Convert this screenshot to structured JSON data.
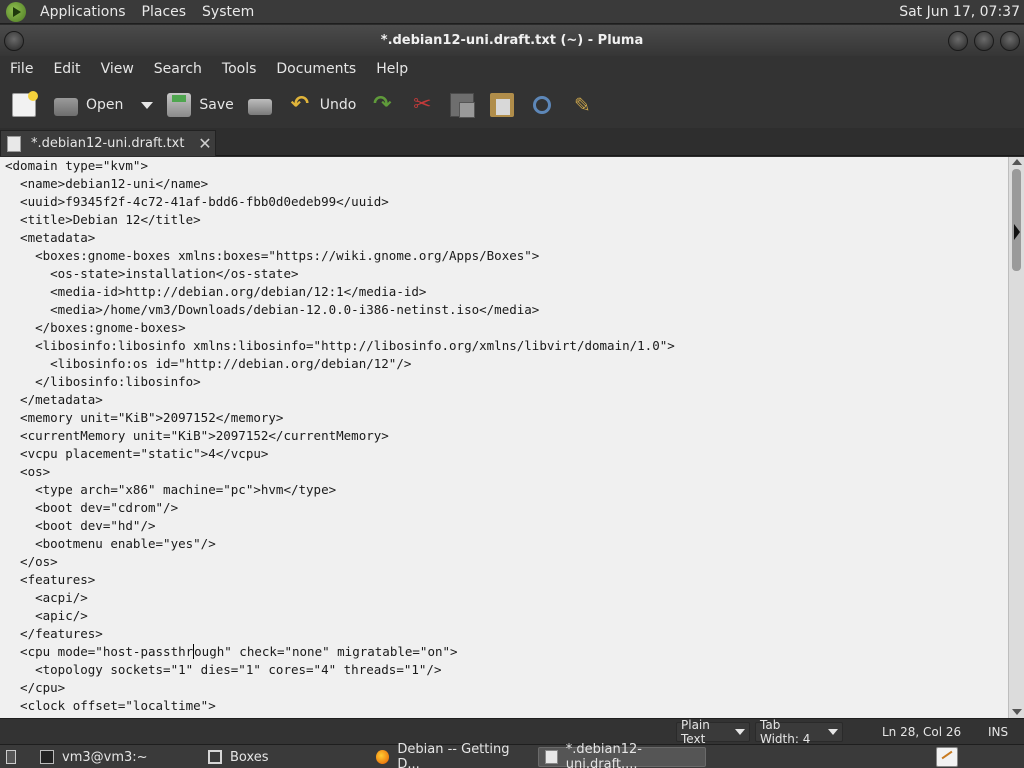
{
  "top_panel": {
    "menus": [
      "Applications",
      "Places",
      "System"
    ],
    "clock": "Sat Jun 17, 07:37"
  },
  "window": {
    "title": "*.debian12-uni.draft.txt (~) - Pluma"
  },
  "menubar": [
    "File",
    "Edit",
    "View",
    "Search",
    "Tools",
    "Documents",
    "Help"
  ],
  "toolbar": {
    "open_label": "Open",
    "save_label": "Save",
    "undo_label": "Undo"
  },
  "tab": {
    "label": "*.debian12-uni.draft.txt"
  },
  "editor": {
    "lines": [
      "<domain type=\"kvm\">",
      "  <name>debian12-uni</name>",
      "  <uuid>f9345f2f-4c72-41af-bdd6-fbb0d0edeb99</uuid>",
      "  <title>Debian 12</title>",
      "  <metadata>",
      "    <boxes:gnome-boxes xmlns:boxes=\"https://wiki.gnome.org/Apps/Boxes\">",
      "      <os-state>installation</os-state>",
      "      <media-id>http://debian.org/debian/12:1</media-id>",
      "      <media>/home/vm3/Downloads/debian-12.0.0-i386-netinst.iso</media>",
      "    </boxes:gnome-boxes>",
      "    <libosinfo:libosinfo xmlns:libosinfo=\"http://libosinfo.org/xmlns/libvirt/domain/1.0\">",
      "      <libosinfo:os id=\"http://debian.org/debian/12\"/>",
      "    </libosinfo:libosinfo>",
      "  </metadata>",
      "  <memory unit=\"KiB\">2097152</memory>",
      "  <currentMemory unit=\"KiB\">2097152</currentMemory>",
      "  <vcpu placement=\"static\">4</vcpu>",
      "  <os>",
      "    <type arch=\"x86\" machine=\"pc\">hvm</type>",
      "    <boot dev=\"cdrom\"/>",
      "    <boot dev=\"hd\"/>",
      "    <bootmenu enable=\"yes\"/>",
      "  </os>",
      "  <features>",
      "    <acpi/>",
      "    <apic/>",
      "  </features>",
      "  <cpu mode=\"host-passthrough\" check=\"none\" migratable=\"on\">",
      "    <topology sockets=\"1\" dies=\"1\" cores=\"4\" threads=\"1\"/>",
      "  </cpu>",
      "  <clock offset=\"localtime\">"
    ],
    "cursor": {
      "line": 28,
      "col": 26
    }
  },
  "statusbar": {
    "language": "Plain Text",
    "tab_width": "Tab Width:  4",
    "position": "Ln 28, Col 26",
    "mode": "INS"
  },
  "taskbar": {
    "items": [
      {
        "label": "vm3@vm3:~",
        "icon": "terminal-icon"
      },
      {
        "label": "Boxes",
        "icon": "boxes-icon"
      },
      {
        "label": "Debian -- Getting D...",
        "icon": "firefox-icon"
      },
      {
        "label": "*.debian12-uni.draft....",
        "icon": "pluma-icon",
        "active": true
      }
    ]
  }
}
